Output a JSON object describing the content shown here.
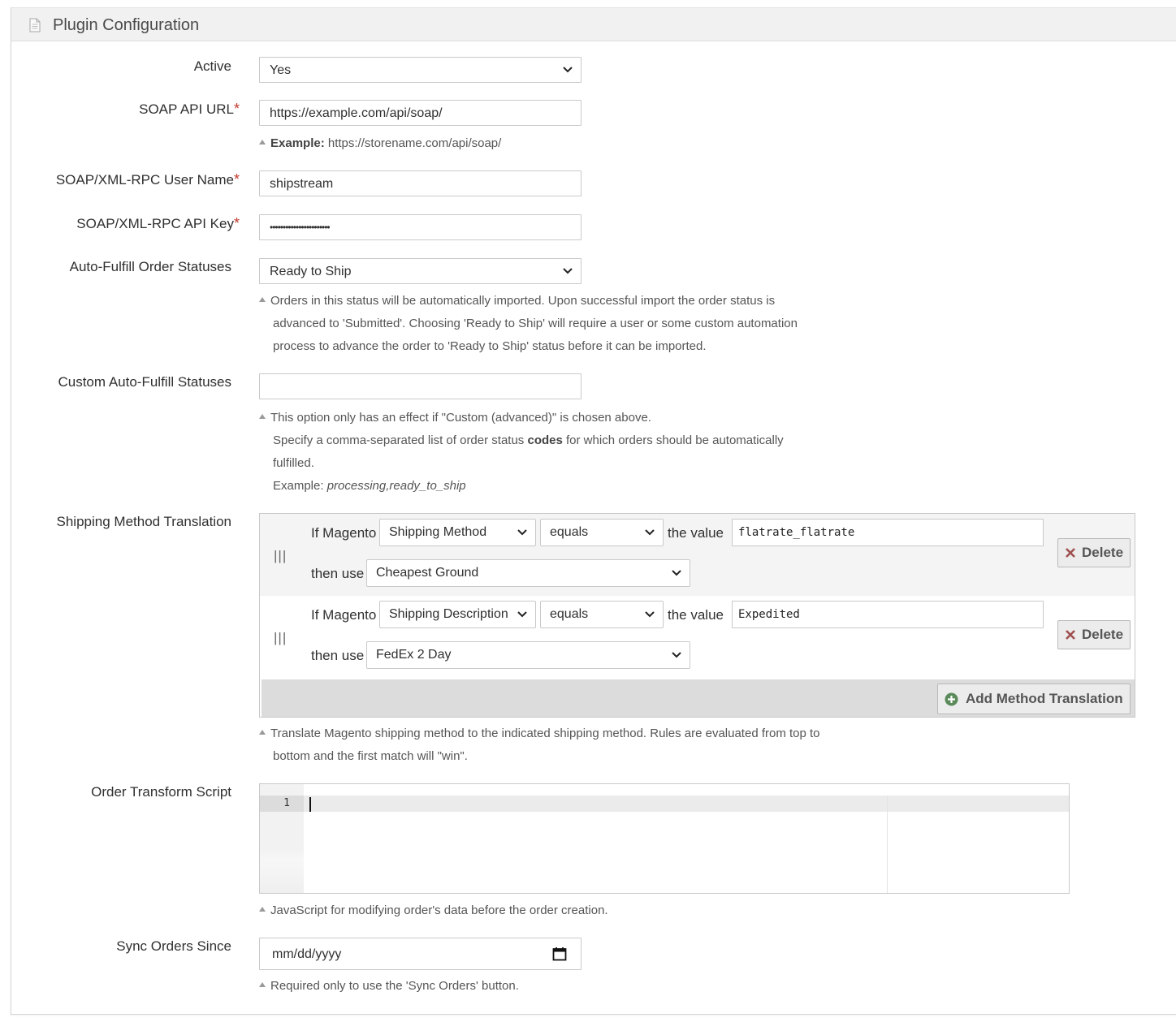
{
  "panel": {
    "title": "Plugin Configuration",
    "icon": "document-icon"
  },
  "fields": {
    "active": {
      "label": "Active",
      "value": "Yes"
    },
    "soap_url": {
      "label": "SOAP API URL",
      "required_mark": "*",
      "value": "https://example.com/api/soap/",
      "note_bold": "Example:",
      "note_text": "https://storename.com/api/soap/"
    },
    "user_name": {
      "label": "SOAP/XML-RPC User Name",
      "required_mark": "*",
      "value": "shipstream"
    },
    "api_key": {
      "label": "SOAP/XML-RPC API Key",
      "required_mark": "*",
      "value": "•••••••••••••••••••••••"
    },
    "auto_fulfill": {
      "label": "Auto-Fulfill Order Statuses",
      "value": "Ready to Ship",
      "note_lines": [
        "Orders in this status will be automatically imported. Upon successful import the order status is",
        "advanced to 'Submitted'. Choosing 'Ready to Ship' will require a user or some custom automation",
        "process to advance the order to 'Ready to Ship' status before it can be imported."
      ]
    },
    "custom_statuses": {
      "label": "Custom Auto-Fulfill Statuses",
      "value": "",
      "note_line1": "This option only has an effect if \"Custom (advanced)\" is chosen above.",
      "note_line2_pre": "Specify a comma-separated list of order status ",
      "note_line2_bold": "codes",
      "note_line2_post": " for which orders should be automatically",
      "note_line3": "fulfilled.",
      "note_line4_pre": "Example: ",
      "note_line4_italic": "processing,ready_to_ship"
    },
    "shipping_translation": {
      "label": "Shipping Method Translation",
      "if_text": "If Magento",
      "the_value_text": "the value",
      "then_use_text": "then use",
      "grip": "|||",
      "delete_label": "Delete",
      "add_label": "Add Method Translation",
      "rows": [
        {
          "field": "Shipping Method",
          "operator": "equals",
          "value": "flatrate_flatrate",
          "method": "Cheapest Ground"
        },
        {
          "field": "Shipping Description",
          "operator": "equals",
          "value": "Expedited",
          "method": "FedEx 2 Day"
        }
      ],
      "note_lines": [
        "Translate Magento shipping method to the indicated shipping method. Rules are evaluated from top to",
        "bottom and the first match will \"win\"."
      ]
    },
    "transform_script": {
      "label": "Order Transform Script",
      "line_number": "1",
      "note": "JavaScript for modifying order's data before the order creation."
    },
    "sync_since": {
      "label": "Sync Orders Since",
      "placeholder": "mm/dd/yyyy",
      "icon": "calendar-icon",
      "note": "Required only to use the 'Sync Orders' button."
    }
  },
  "colors": {
    "required": "#c0392b",
    "add_icon": "#5a8a5a",
    "delete_icon": "#a05050"
  }
}
